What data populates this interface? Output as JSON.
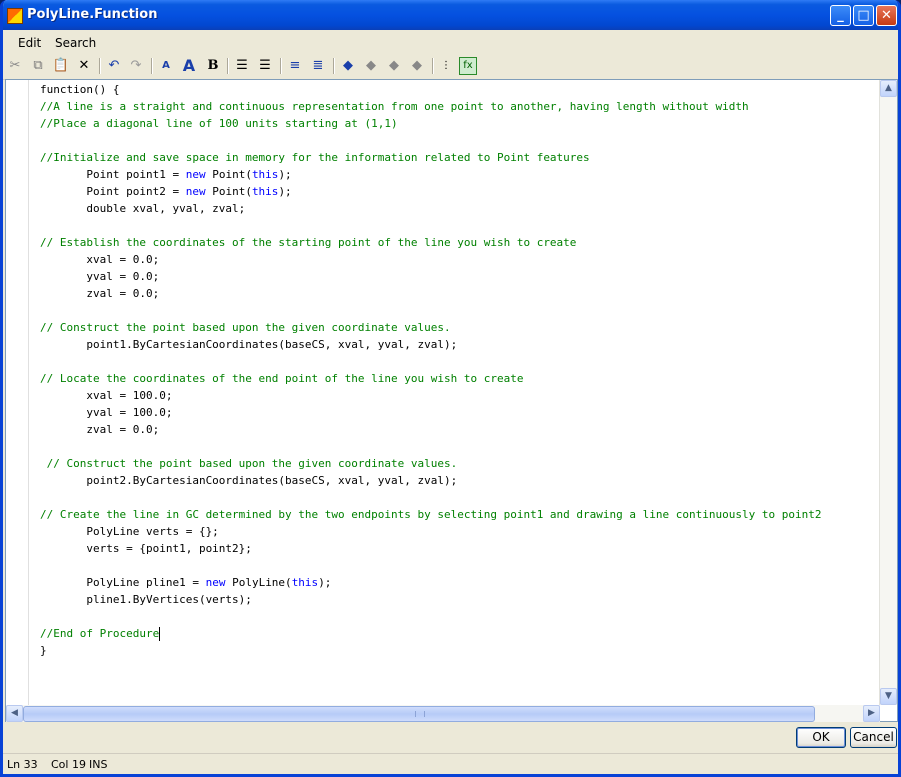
{
  "window": {
    "title": "PolyLine.Function"
  },
  "menu": [
    "Edit",
    "Search"
  ],
  "toolbar_icons": [
    "cut-icon",
    "copy-icon",
    "paste-icon",
    "delete-icon",
    "undo-icon",
    "redo-icon",
    "decrease-font-icon",
    "increase-font-icon",
    "bold-icon",
    "indent-icon",
    "outdent-icon",
    "comment-icon",
    "uncomment-icon",
    "bookmark-toggle-icon",
    "bookmark-next-icon",
    "bookmark-prev-icon",
    "bookmark-clear-icon",
    "insert-snippet-icon",
    "function-icon"
  ],
  "code_lines": [
    "function() {",
    "//A line is a straight and continuous representation from one point to another, having length without width",
    "//Place a diagonal line of 100 units starting at (1,1)",
    "",
    "//Initialize and save space in memory for the information related to Point features",
    "       Point point1 = new Point(this);",
    "       Point point2 = new Point(this);",
    "       double xval, yval, zval;",
    "",
    "// Establish the coordinates of the starting point of the line you wish to create",
    "       xval = 0.0;",
    "       yval = 0.0;",
    "       zval = 0.0;",
    "",
    "// Construct the point based upon the given coordinate values.",
    "       point1.ByCartesianCoordinates(baseCS, xval, yval, zval);",
    "",
    "// Locate the coordinates of the end point of the line you wish to create",
    "       xval = 100.0;",
    "       yval = 100.0;",
    "       zval = 0.0;",
    "",
    " // Construct the point based upon the given coordinate values.",
    "       point2.ByCartesianCoordinates(baseCS, xval, yval, zval);",
    "",
    "// Create the line in GC determined by the two endpoints by selecting point1 and drawing a line continuously to point2",
    "       PolyLine verts = {};",
    "       verts = {point1, point2};",
    "",
    "       PolyLine pline1 = new PolyLine(this);",
    "       pline1.ByVertices(verts);",
    "",
    "//End of Procedure",
    "}"
  ],
  "buttons": {
    "ok": "OK",
    "cancel": "Cancel"
  },
  "status": {
    "line": "Ln 33",
    "col": "Col 19",
    "mode": "INS"
  },
  "colors": {
    "comment": "#008000",
    "keyword": "#0000ff",
    "title_bar": "#0551e0"
  }
}
